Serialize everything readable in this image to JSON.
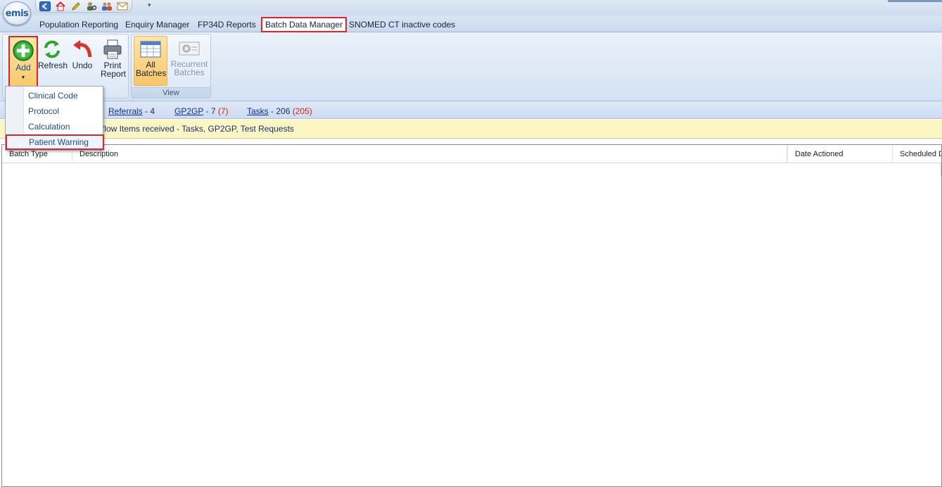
{
  "app": {
    "logo_text": "emis"
  },
  "tabs": [
    {
      "label": "Population Reporting"
    },
    {
      "label": "Enquiry Manager"
    },
    {
      "label": "FP34D Reports"
    },
    {
      "label": "Batch Data Manager"
    },
    {
      "label": "SNOMED CT inactive codes"
    }
  ],
  "ribbon": {
    "groups": {
      "actions": {
        "add_label": "Add",
        "refresh_label": "Refresh",
        "undo_label": "Undo",
        "print_label": "Print Report"
      },
      "view": {
        "label": "View",
        "all_batches_label": "All Batches",
        "recurrent_batches_label": "Recurrent Batches"
      }
    }
  },
  "add_menu": {
    "items": [
      {
        "label": "Clinical Code"
      },
      {
        "label": "Protocol"
      },
      {
        "label": "Calculation"
      },
      {
        "label": "Patient Warning"
      }
    ]
  },
  "workflow": {
    "referrals_label": "Referrals",
    "referrals_count": "- 4",
    "gp2gp_label": "GP2GP",
    "gp2gp_count": "- 7",
    "gp2gp_red": "(7)",
    "tasks_label": "Tasks",
    "tasks_count": "- 206",
    "tasks_red": "(205)"
  },
  "info": {
    "message": "flow Items received - Tasks, GP2GP, Test Requests"
  },
  "grid": {
    "columns": [
      {
        "label": "Batch Type"
      },
      {
        "label": "Description"
      },
      {
        "label": "Date Actioned"
      },
      {
        "label": "Scheduled Date"
      }
    ]
  },
  "colors": {
    "highlight_red": "#e0242b",
    "ribbon_blue": "#d4e2f3",
    "info_yellow": "#fbf6c2",
    "link_blue": "#0b2fae"
  }
}
